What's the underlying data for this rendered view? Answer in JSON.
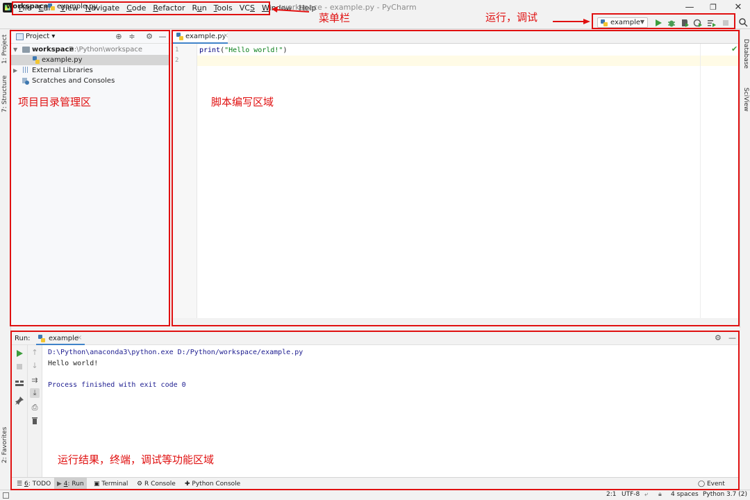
{
  "window": {
    "title": "workspace - example.py - PyCharm",
    "minimize": "—",
    "maximize": "❐",
    "close": "✕"
  },
  "menu": [
    {
      "pre": "",
      "mn": "F",
      "post": "ile"
    },
    {
      "pre": "",
      "mn": "E",
      "post": "dit"
    },
    {
      "pre": "",
      "mn": "V",
      "post": "iew"
    },
    {
      "pre": "",
      "mn": "N",
      "post": "avigate"
    },
    {
      "pre": "",
      "mn": "C",
      "post": "ode"
    },
    {
      "pre": "",
      "mn": "R",
      "post": "efactor"
    },
    {
      "pre": "R",
      "mn": "u",
      "post": "n"
    },
    {
      "pre": "",
      "mn": "T",
      "post": "ools"
    },
    {
      "pre": "VC",
      "mn": "S",
      "post": ""
    },
    {
      "pre": "",
      "mn": "W",
      "post": "indow"
    },
    {
      "pre": "",
      "mn": "H",
      "post": "elp"
    }
  ],
  "breadcrumb": {
    "root": "workspace",
    "separator": "〉",
    "file": "example.py"
  },
  "run_config": {
    "name": "example",
    "arrow": "▼"
  },
  "left_strip": {
    "project": "1: Project",
    "structure": "7: Structure",
    "favorites": "2: Favorites"
  },
  "right_strip": {
    "database": "Database",
    "sciview": "SciView"
  },
  "project": {
    "header": "Project ▾",
    "tree": {
      "root_name": "workspace",
      "root_path": "D:\\Python\\workspace",
      "file": "example.py",
      "external_libraries": "External Libraries",
      "scratches": "Scratches and Consoles"
    }
  },
  "editor": {
    "tab_label": "example.py",
    "tab_close": "×",
    "line_numbers": [
      "1",
      "2"
    ],
    "code": {
      "fn": "print",
      "open": "(",
      "str": "\"Hello world!\"",
      "close": ")"
    }
  },
  "run_panel": {
    "label": "Run:",
    "tab": "example",
    "tab_close": "×",
    "console": {
      "command": "D:\\Python\\anaconda3\\python.exe D:/Python/workspace/example.py",
      "output": "Hello world!",
      "exit": "Process finished with exit code 0"
    }
  },
  "bottom_tabs": [
    {
      "icon": "☰",
      "pre": "",
      "mn": "6",
      "post": ": TODO"
    },
    {
      "icon": "▶",
      "pre": "",
      "mn": "4",
      "post": ": Run"
    },
    {
      "icon": "▣",
      "pre": "",
      "mn": "",
      "post": "Terminal"
    },
    {
      "icon": "⚙",
      "pre": "",
      "mn": "",
      "post": "R Console"
    },
    {
      "icon": "✚",
      "pre": "",
      "mn": "",
      "post": "Python Console"
    }
  ],
  "event_log": "Event Log",
  "status": {
    "position": "2:1",
    "encoding": "UTF-8",
    "indent": "4 spaces",
    "interpreter": "Python 3.7 (2)"
  },
  "annotations": {
    "menu_bar": "菜单栏",
    "run_debug": "运行，调试",
    "project_area": "项目目录管理区",
    "editor_area": "脚本编写区域",
    "run_area": "运行结果，终端，调试等功能区域"
  },
  "colors": {
    "annotation": "#e01010",
    "run_green": "#3c9d3c",
    "debug_green": "#499c54",
    "tab_underline": "#4083c9"
  }
}
